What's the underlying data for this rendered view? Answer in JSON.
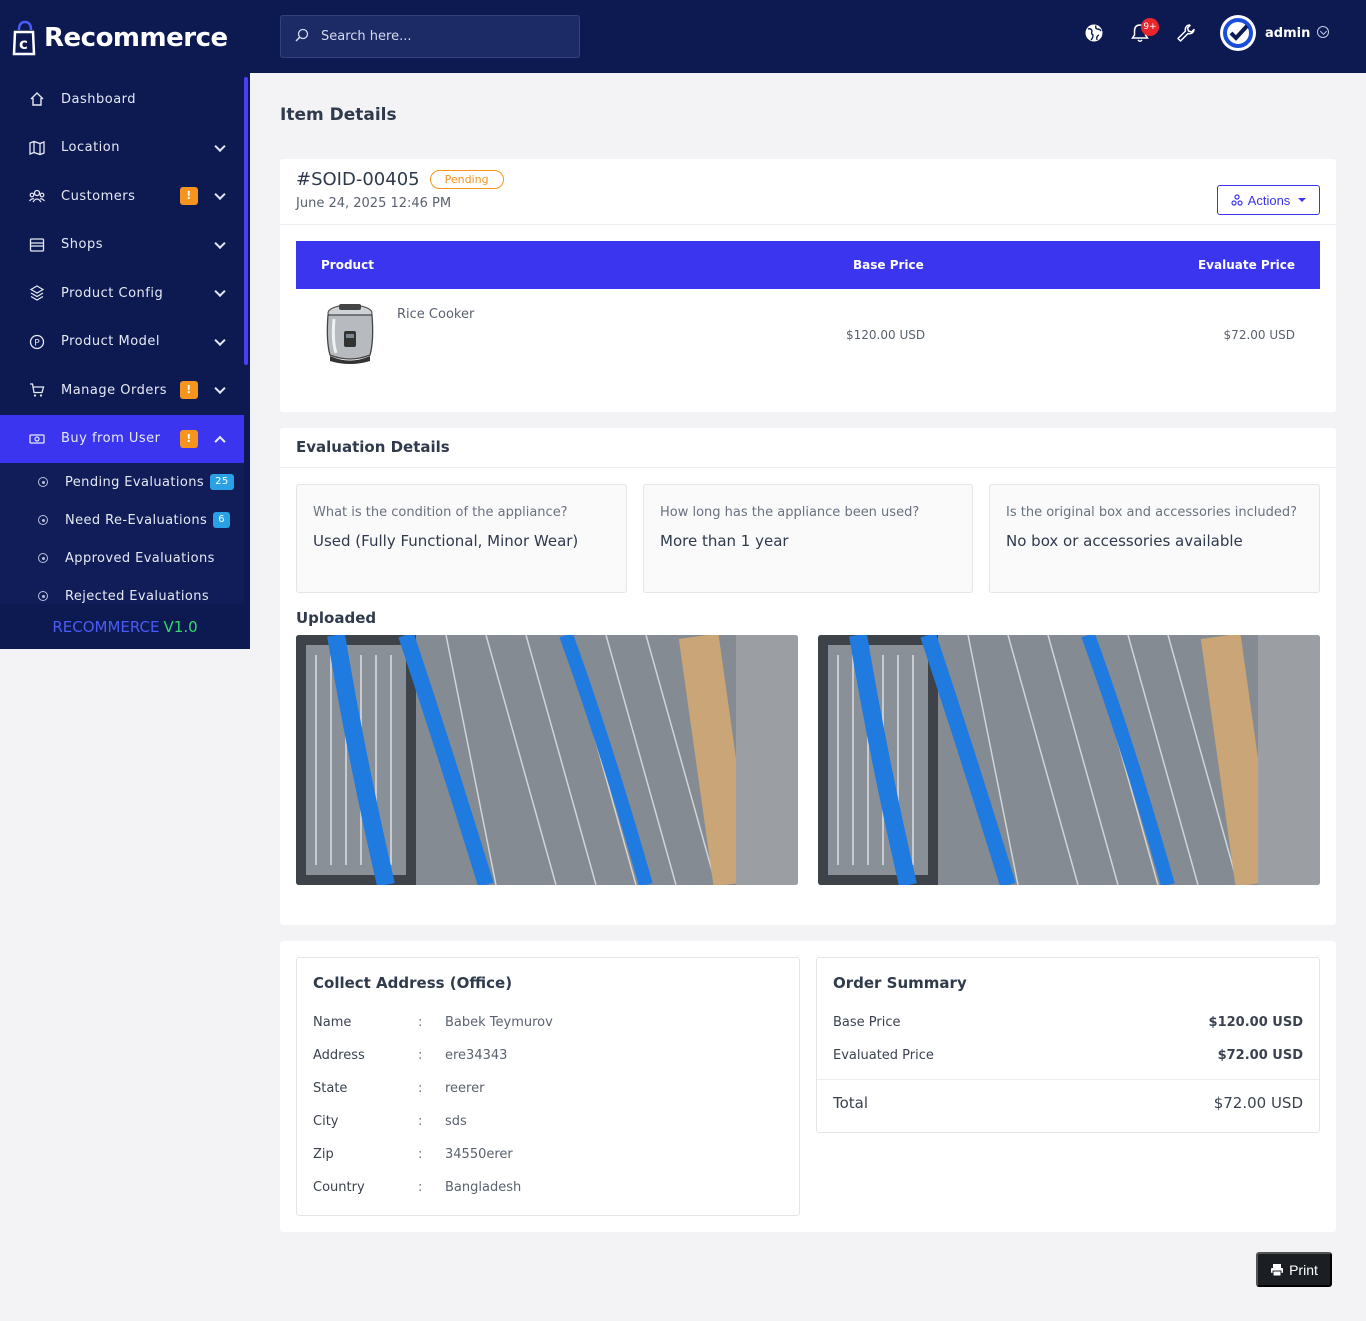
{
  "brand": {
    "name": "Recommerce"
  },
  "search": {
    "placeholder": "Search here..."
  },
  "header": {
    "notification_count": "9+",
    "user_name": "admin"
  },
  "sidebar": {
    "items": [
      {
        "label": "Dashboard",
        "icon": "home-icon"
      },
      {
        "label": "Location",
        "icon": "map-icon"
      },
      {
        "label": "Customers",
        "icon": "users-icon",
        "badge": "!"
      },
      {
        "label": "Shops",
        "icon": "store-icon"
      },
      {
        "label": "Product Config",
        "icon": "grid-icon"
      },
      {
        "label": "Product Model",
        "icon": "p-circle-icon"
      },
      {
        "label": "Manage Orders",
        "icon": "cart-icon",
        "badge": "!"
      },
      {
        "label": "Buy from User",
        "icon": "cash-icon",
        "badge": "!"
      }
    ],
    "sub_items": [
      {
        "label": "Pending Evaluations",
        "badge": "25"
      },
      {
        "label": "Need Re-Evaluations",
        "badge": "6"
      },
      {
        "label": "Approved Evaluations"
      },
      {
        "label": "Rejected Evaluations"
      }
    ],
    "footer_name": "RECOMMERCE",
    "footer_version": "V1.0"
  },
  "page": {
    "title": "Item Details"
  },
  "order": {
    "id": "#SOID-00405",
    "status": "Pending",
    "date": "June 24, 2025 12:46 PM",
    "actions_label": "Actions",
    "table": {
      "headers": [
        "Product",
        "Base Price",
        "Evaluate Price"
      ],
      "rows": [
        {
          "product": "Rice Cooker",
          "base_price": "$120.00 USD",
          "evaluate_price": "$72.00 USD"
        }
      ]
    }
  },
  "evaluation": {
    "title": "Evaluation Details",
    "questions": [
      {
        "q": "What is the condition of the appliance?",
        "a": "Used (Fully Functional, Minor Wear)"
      },
      {
        "q": "How long has the appliance been used?",
        "a": "More than 1 year"
      },
      {
        "q": "Is the original box and accessories included?",
        "a": "No box or accessories available"
      }
    ],
    "uploaded_label": "Uploaded"
  },
  "address": {
    "title": "Collect Address (Office)",
    "rows": [
      {
        "k": "Name",
        "v": "Babek Teymurov"
      },
      {
        "k": "Address",
        "v": "ere34343"
      },
      {
        "k": "State",
        "v": "reerer"
      },
      {
        "k": "City",
        "v": "sds"
      },
      {
        "k": "Zip",
        "v": "34550erer"
      },
      {
        "k": "Country",
        "v": "Bangladesh"
      }
    ],
    "separator": ":"
  },
  "summary": {
    "title": "Order Summary",
    "base_price_label": "Base Price",
    "base_price": "$120.00 USD",
    "evaluated_price_label": "Evaluated Price",
    "evaluated_price": "$72.00 USD",
    "total_label": "Total",
    "total": "$72.00 USD"
  },
  "print_label": "Print",
  "colors": {
    "sidebar_bg": "#0d1a52",
    "accent": "#3b35f0",
    "warning": "#f7941d",
    "badge_blue": "#2aa0e6"
  }
}
